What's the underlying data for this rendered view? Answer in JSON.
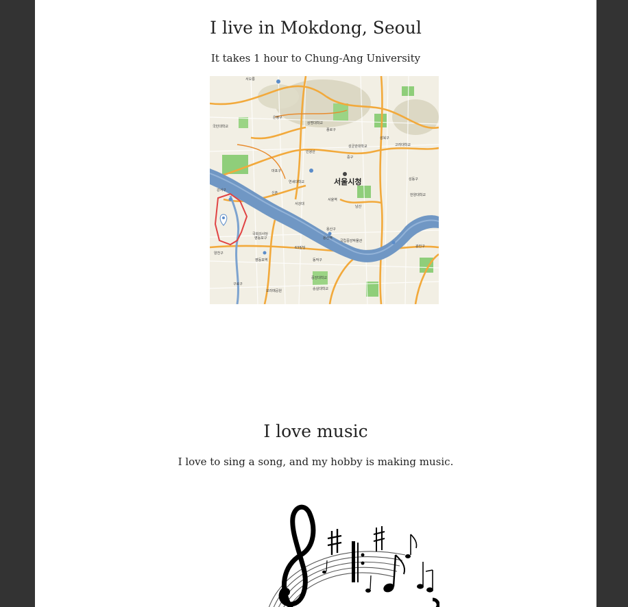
{
  "section_home": {
    "heading": "I live in Mokdong, Seoul",
    "caption": "It takes 1 hour to Chung-Ang University"
  },
  "map": {
    "city_label": "서울시청",
    "district_labels": [
      "은평구",
      "종로구",
      "성북구",
      "마포구",
      "중구",
      "용산구",
      "성동구",
      "영등포구",
      "동작구",
      "강서구",
      "양천구",
      "구로구",
      "광진구"
    ],
    "place_labels": [
      "서오릉",
      "국민대학교",
      "상명대학교",
      "성균관대학교",
      "인왕산",
      "연세대학교",
      "서강대",
      "신촌",
      "서울역",
      "남산",
      "국회의사당",
      "63빌딩",
      "용산역",
      "국립중앙박물관",
      "중앙대학교",
      "숭실대학교",
      "고려대학교",
      "한양대학교",
      "영등포역",
      "보라매공원"
    ]
  },
  "section_music": {
    "heading": "I love music",
    "caption": "I love to sing a song, and my hobby is making music."
  }
}
